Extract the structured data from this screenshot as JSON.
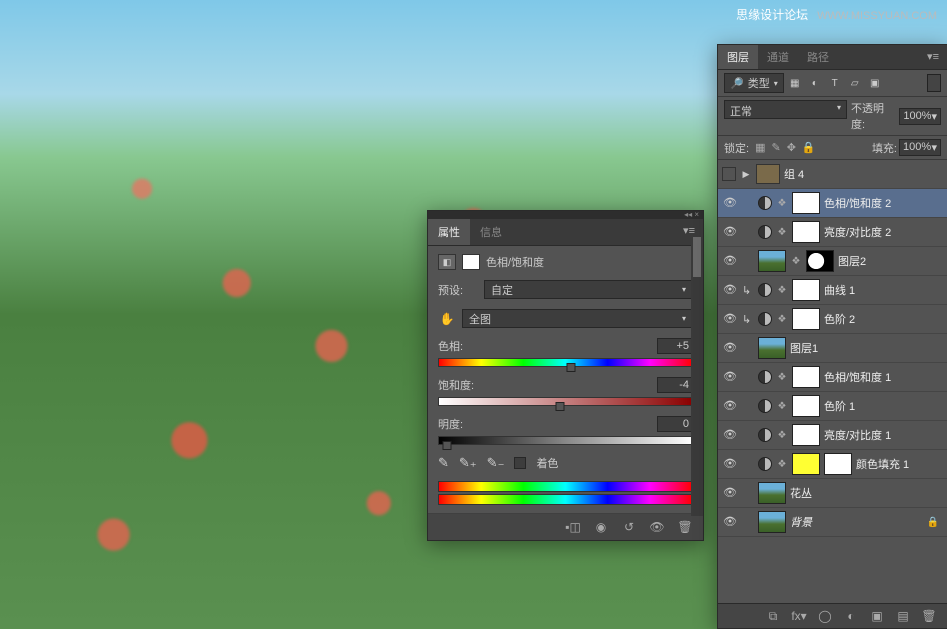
{
  "watermark": {
    "title": "思缘设计论坛",
    "url": "WWW.MISSYUAN.COM"
  },
  "props": {
    "tabs": {
      "properties": "属性",
      "info": "信息"
    },
    "title": "色相/饱和度",
    "preset_label": "预设:",
    "preset_value": "自定",
    "channel_value": "全图",
    "hue": {
      "label": "色相:",
      "value": "+5"
    },
    "saturation": {
      "label": "饱和度:",
      "value": "-4"
    },
    "lightness": {
      "label": "明度:",
      "value": "0"
    },
    "colorize": "着色"
  },
  "layers": {
    "tabs": {
      "layers": "图层",
      "channels": "通道",
      "paths": "路径"
    },
    "kind": "类型",
    "mode": "正常",
    "opacity_label": "不透明度:",
    "opacity_value": "100%",
    "lock_label": "锁定:",
    "fill_label": "填充:",
    "fill_value": "100%",
    "items": [
      {
        "name": "组 4",
        "type": "group"
      },
      {
        "name": "色相/饱和度 2",
        "type": "adj",
        "selected": true
      },
      {
        "name": "亮度/对比度 2",
        "type": "adj"
      },
      {
        "name": "图层2",
        "type": "imgmask"
      },
      {
        "name": "曲线 1",
        "type": "adj",
        "clip": true
      },
      {
        "name": "色阶 2",
        "type": "adj",
        "clip": true
      },
      {
        "name": "图层1",
        "type": "img"
      },
      {
        "name": "色相/饱和度 1",
        "type": "adj"
      },
      {
        "name": "色阶 1",
        "type": "adj"
      },
      {
        "name": "亮度/对比度 1",
        "type": "adj"
      },
      {
        "name": "颜色填充 1",
        "type": "fill"
      },
      {
        "name": "花丛",
        "type": "img"
      },
      {
        "name": "背景",
        "type": "bg",
        "locked": true
      }
    ]
  }
}
